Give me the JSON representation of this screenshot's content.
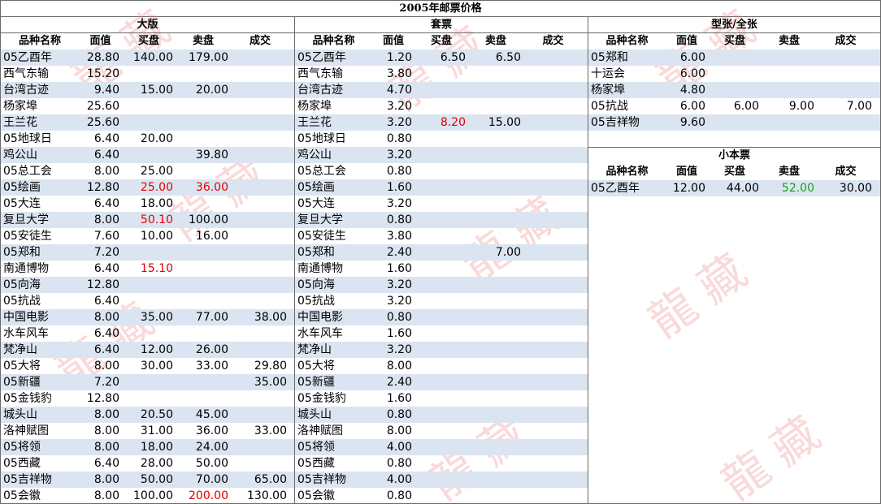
{
  "title": "2005年邮票价格",
  "sections": {
    "large": {
      "header": "大版",
      "columns": [
        "品种名称",
        "面值",
        "买盘",
        "卖盘",
        "成交"
      ],
      "rows": [
        {
          "name": "05乙酉年",
          "face": "28.80",
          "buy": "140.00",
          "sell": "179.00",
          "deal": ""
        },
        {
          "name": "西气东输",
          "face": "15.20",
          "buy": "",
          "sell": "",
          "deal": ""
        },
        {
          "name": "台湾古迹",
          "face": "9.40",
          "buy": "15.00",
          "sell": "20.00",
          "deal": ""
        },
        {
          "name": "杨家埠",
          "face": "25.60",
          "buy": "",
          "sell": "",
          "deal": ""
        },
        {
          "name": "王兰花",
          "face": "25.60",
          "buy": "",
          "sell": "",
          "deal": ""
        },
        {
          "name": "05地球日",
          "face": "6.40",
          "buy": "20.00",
          "sell": "",
          "deal": ""
        },
        {
          "name": "鸡公山",
          "face": "6.40",
          "buy": "",
          "sell": "39.80",
          "deal": ""
        },
        {
          "name": "05总工会",
          "face": "8.00",
          "buy": "25.00",
          "sell": "",
          "deal": ""
        },
        {
          "name": "05绘画",
          "face": "12.80",
          "buy": "25.00",
          "sell": "36.00",
          "deal": "",
          "buy_color": "red",
          "sell_color": "red"
        },
        {
          "name": "05大连",
          "face": "6.40",
          "buy": "18.00",
          "sell": "",
          "deal": ""
        },
        {
          "name": "复旦大学",
          "face": "8.00",
          "buy": "50.10",
          "sell": "100.00",
          "deal": "",
          "buy_color": "red"
        },
        {
          "name": "05安徒生",
          "face": "7.60",
          "buy": "10.00",
          "sell": "16.00",
          "deal": ""
        },
        {
          "name": "05郑和",
          "face": "7.20",
          "buy": "",
          "sell": "",
          "deal": ""
        },
        {
          "name": "南通博物",
          "face": "6.40",
          "buy": "15.10",
          "sell": "",
          "deal": "",
          "buy_color": "red"
        },
        {
          "name": "05向海",
          "face": "12.80",
          "buy": "",
          "sell": "",
          "deal": ""
        },
        {
          "name": "05抗战",
          "face": "6.40",
          "buy": "",
          "sell": "",
          "deal": ""
        },
        {
          "name": "中国电影",
          "face": "8.00",
          "buy": "35.00",
          "sell": "77.00",
          "deal": "38.00"
        },
        {
          "name": "水车风车",
          "face": "6.40",
          "buy": "",
          "sell": "",
          "deal": ""
        },
        {
          "name": "梵净山",
          "face": "6.40",
          "buy": "12.00",
          "sell": "26.00",
          "deal": ""
        },
        {
          "name": "05大将",
          "face": "8.00",
          "buy": "30.00",
          "sell": "33.00",
          "deal": "29.80"
        },
        {
          "name": "05新疆",
          "face": "7.20",
          "buy": "",
          "sell": "",
          "deal": "35.00"
        },
        {
          "name": "05金钱豹",
          "face": "12.80",
          "buy": "",
          "sell": "",
          "deal": ""
        },
        {
          "name": "城头山",
          "face": "8.00",
          "buy": "20.50",
          "sell": "45.00",
          "deal": ""
        },
        {
          "name": "洛神赋图",
          "face": "8.00",
          "buy": "31.00",
          "sell": "36.00",
          "deal": "33.00"
        },
        {
          "name": "05将领",
          "face": "8.00",
          "buy": "18.00",
          "sell": "24.00",
          "deal": ""
        },
        {
          "name": "05西藏",
          "face": "6.40",
          "buy": "28.00",
          "sell": "50.00",
          "deal": ""
        },
        {
          "name": "05吉祥物",
          "face": "8.00",
          "buy": "50.00",
          "sell": "70.00",
          "deal": "65.00"
        },
        {
          "name": "05会徽",
          "face": "8.00",
          "buy": "100.00",
          "sell": "200.00",
          "deal": "130.00",
          "sell_color": "red"
        }
      ]
    },
    "set": {
      "header": "套票",
      "columns": [
        "品种名称",
        "面值",
        "买盘",
        "卖盘",
        "成交"
      ],
      "rows": [
        {
          "name": "05乙酉年",
          "face": "1.20",
          "buy": "6.50",
          "sell": "6.50",
          "deal": ""
        },
        {
          "name": "西气东输",
          "face": "3.80",
          "buy": "",
          "sell": "",
          "deal": ""
        },
        {
          "name": "台湾古迹",
          "face": "4.70",
          "buy": "",
          "sell": "",
          "deal": ""
        },
        {
          "name": "杨家埠",
          "face": "3.20",
          "buy": "",
          "sell": "",
          "deal": ""
        },
        {
          "name": "王兰花",
          "face": "3.20",
          "buy": "8.20",
          "sell": "15.00",
          "deal": "",
          "buy_color": "red"
        },
        {
          "name": "05地球日",
          "face": "0.80",
          "buy": "",
          "sell": "",
          "deal": ""
        },
        {
          "name": "鸡公山",
          "face": "3.20",
          "buy": "",
          "sell": "",
          "deal": ""
        },
        {
          "name": "05总工会",
          "face": "0.80",
          "buy": "",
          "sell": "",
          "deal": ""
        },
        {
          "name": "05绘画",
          "face": "1.60",
          "buy": "",
          "sell": "",
          "deal": ""
        },
        {
          "name": "05大连",
          "face": "3.20",
          "buy": "",
          "sell": "",
          "deal": ""
        },
        {
          "name": "复旦大学",
          "face": "0.80",
          "buy": "",
          "sell": "",
          "deal": ""
        },
        {
          "name": "05安徒生",
          "face": "3.80",
          "buy": "",
          "sell": "",
          "deal": ""
        },
        {
          "name": "05郑和",
          "face": "2.40",
          "buy": "",
          "sell": "7.00",
          "deal": ""
        },
        {
          "name": "南通博物",
          "face": "1.60",
          "buy": "",
          "sell": "",
          "deal": ""
        },
        {
          "name": "05向海",
          "face": "3.20",
          "buy": "",
          "sell": "",
          "deal": ""
        },
        {
          "name": "05抗战",
          "face": "3.20",
          "buy": "",
          "sell": "",
          "deal": ""
        },
        {
          "name": "中国电影",
          "face": "0.80",
          "buy": "",
          "sell": "",
          "deal": ""
        },
        {
          "name": "水车风车",
          "face": "1.60",
          "buy": "",
          "sell": "",
          "deal": ""
        },
        {
          "name": "梵净山",
          "face": "3.20",
          "buy": "",
          "sell": "",
          "deal": ""
        },
        {
          "name": "05大将",
          "face": "8.00",
          "buy": "",
          "sell": "",
          "deal": ""
        },
        {
          "name": "05新疆",
          "face": "2.40",
          "buy": "",
          "sell": "",
          "deal": ""
        },
        {
          "name": "05金钱豹",
          "face": "1.60",
          "buy": "",
          "sell": "",
          "deal": ""
        },
        {
          "name": "城头山",
          "face": "0.80",
          "buy": "",
          "sell": "",
          "deal": ""
        },
        {
          "name": "洛神赋图",
          "face": "8.00",
          "buy": "",
          "sell": "",
          "deal": ""
        },
        {
          "name": "05将领",
          "face": "4.00",
          "buy": "",
          "sell": "",
          "deal": ""
        },
        {
          "name": "05西藏",
          "face": "0.80",
          "buy": "",
          "sell": "",
          "deal": ""
        },
        {
          "name": "05吉祥物",
          "face": "4.00",
          "buy": "",
          "sell": "",
          "deal": ""
        },
        {
          "name": "05会徽",
          "face": "0.80",
          "buy": "",
          "sell": "",
          "deal": ""
        }
      ]
    },
    "sheetlet": {
      "header": "型张/全张",
      "columns": [
        "品种名称",
        "面值",
        "买盘",
        "卖盘",
        "成交"
      ],
      "rows": [
        {
          "name": "05郑和",
          "face": "6.00",
          "buy": "",
          "sell": "",
          "deal": ""
        },
        {
          "name": "十运会",
          "face": "6.00",
          "buy": "",
          "sell": "",
          "deal": ""
        },
        {
          "name": "杨家埠",
          "face": "4.80",
          "buy": "",
          "sell": "",
          "deal": ""
        },
        {
          "name": "05抗战",
          "face": "6.00",
          "buy": "6.00",
          "sell": "9.00",
          "deal": "7.00"
        },
        {
          "name": "05吉祥物",
          "face": "9.60",
          "buy": "",
          "sell": "",
          "deal": ""
        }
      ]
    },
    "booklet": {
      "header": "小本票",
      "columns": [
        "品种名称",
        "面值",
        "买盘",
        "卖盘",
        "成交"
      ],
      "rows": [
        {
          "name": "05乙酉年",
          "face": "12.00",
          "buy": "44.00",
          "sell": "52.00",
          "deal": "30.00",
          "sell_color": "green"
        }
      ]
    }
  },
  "colors": {
    "border": "#6a6a6a",
    "alt_row": "#dbe5f1",
    "red": "#e00000",
    "green": "#18a018",
    "watermark": "#eb7878"
  }
}
